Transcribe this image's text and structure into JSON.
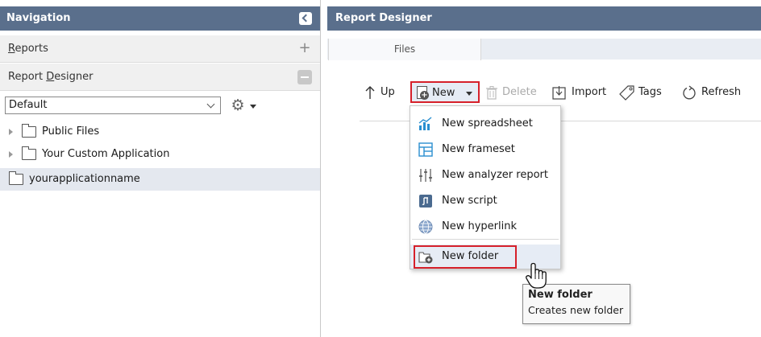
{
  "navigation": {
    "title": "Navigation",
    "reports_label_underlined": "R",
    "reports_label_rest": "eports",
    "designer_label_pre": "Report ",
    "designer_label_underlined": "D",
    "designer_label_rest": "esigner",
    "filter_value": "Default",
    "tree": [
      {
        "label": "Public Files",
        "expandable": true
      },
      {
        "label": "Your Custom Application",
        "expandable": true
      },
      {
        "label": "yourapplicationname",
        "expandable": false,
        "selected": true
      }
    ]
  },
  "designer": {
    "title": "Report Designer",
    "tabs": [
      {
        "label": "Files"
      }
    ],
    "toolbar": {
      "up": "Up",
      "new": "New",
      "delete": "Delete",
      "import": "Import",
      "tags": "Tags",
      "refresh": "Refresh"
    }
  },
  "new_menu": {
    "items": [
      {
        "label": "New spreadsheet",
        "icon": "spreadsheet-icon"
      },
      {
        "label": "New frameset",
        "icon": "frameset-icon"
      },
      {
        "label": "New analyzer report",
        "icon": "analyzer-icon"
      },
      {
        "label": "New script",
        "icon": "script-icon"
      },
      {
        "label": "New hyperlink",
        "icon": "globe-icon"
      },
      {
        "label": "New folder",
        "icon": "new-folder-icon",
        "highlighted": true
      }
    ]
  },
  "tooltip": {
    "title": "New folder",
    "body": "Creates new folder"
  },
  "colors": {
    "header": "#5a6f8c",
    "highlight_border": "#d6202a",
    "selection": "#e4e8ef"
  }
}
